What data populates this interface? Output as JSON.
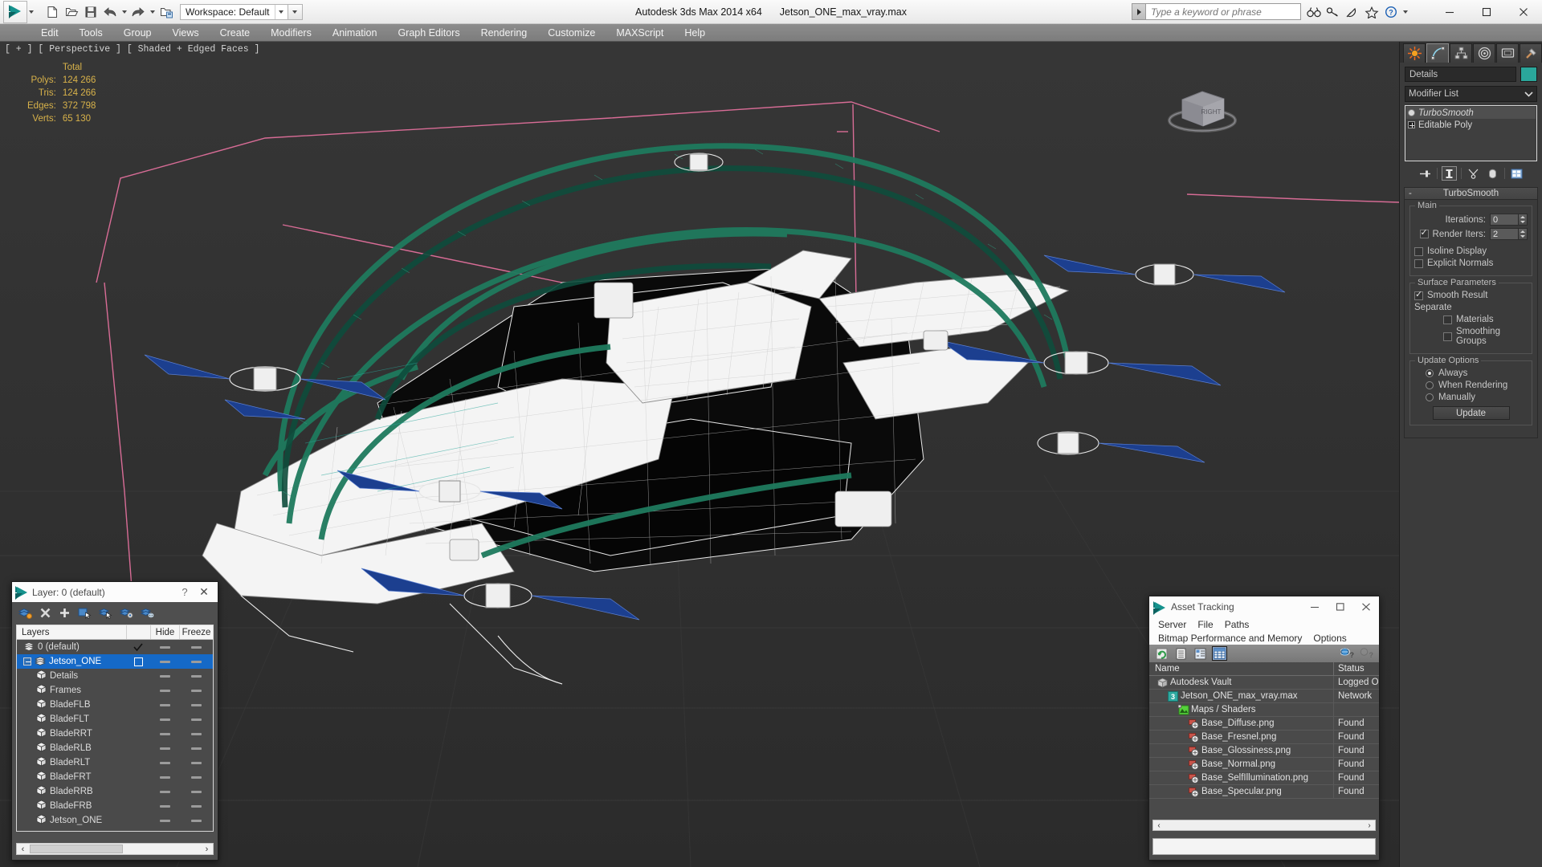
{
  "app": {
    "title": "Autodesk 3ds Max  2014 x64",
    "filename": "Jetson_ONE_max_vray.max",
    "workspace_label": "Workspace: Default",
    "search_placeholder": "Type a keyword or phrase"
  },
  "quick_access": [
    {
      "name": "new-file-icon",
      "glyph": "new"
    },
    {
      "name": "open-file-icon",
      "glyph": "open"
    },
    {
      "name": "save-file-icon",
      "glyph": "save"
    },
    {
      "name": "undo-icon",
      "glyph": "undo"
    },
    {
      "name": "undo-dropdown-icon",
      "glyph": "caret"
    },
    {
      "name": "redo-icon",
      "glyph": "redo"
    },
    {
      "name": "redo-dropdown-icon",
      "glyph": "caret"
    },
    {
      "name": "set-project-folder-icon",
      "glyph": "project"
    }
  ],
  "help_icons": [
    {
      "name": "search-binoculars-icon",
      "glyph": "binoculars"
    },
    {
      "name": "key-icon",
      "glyph": "key"
    },
    {
      "name": "satellite-dish-icon",
      "glyph": "dish"
    },
    {
      "name": "favorites-star-icon",
      "glyph": "star"
    },
    {
      "name": "help-icon",
      "glyph": "question"
    }
  ],
  "window_controls": [
    {
      "name": "minimize-button",
      "glyph": "—"
    },
    {
      "name": "maximize-button",
      "glyph": "☐"
    },
    {
      "name": "close-button",
      "glyph": "✕"
    }
  ],
  "menu": [
    "Edit",
    "Tools",
    "Group",
    "Views",
    "Create",
    "Modifiers",
    "Animation",
    "Graph Editors",
    "Rendering",
    "Customize",
    "MAXScript",
    "Help"
  ],
  "viewport": {
    "label": "[ + ] [ Perspective ] [ Shaded + Edged Faces ]",
    "viewcube_face": "RIGHT",
    "stats": {
      "header": "Total",
      "rows": [
        {
          "label": "Polys:",
          "value": "124 266"
        },
        {
          "label": "Tris:",
          "value": "124 266"
        },
        {
          "label": "Edges:",
          "value": "372 798"
        },
        {
          "label": "Verts:",
          "value": "65 130"
        }
      ]
    }
  },
  "command_panel": {
    "tabs": [
      {
        "name": "create-tab",
        "icon": "star-burst",
        "selected": false
      },
      {
        "name": "modify-tab",
        "icon": "curve",
        "selected": true
      },
      {
        "name": "hierarchy-tab",
        "icon": "hierarchy",
        "selected": false
      },
      {
        "name": "motion-tab",
        "icon": "target-rings",
        "selected": false
      },
      {
        "name": "display-tab",
        "icon": "monitor",
        "selected": false
      },
      {
        "name": "utilities-tab",
        "icon": "hammer",
        "selected": false
      }
    ],
    "object_name": "Details",
    "object_color": "#2aa79b",
    "modifier_list_label": "Modifier List",
    "stack": [
      {
        "name": "TurboSmooth",
        "selected": true,
        "italic": true
      },
      {
        "name": "Editable Poly",
        "selected": false,
        "italic": false
      }
    ],
    "stack_tools": [
      {
        "name": "pin-stack-icon"
      },
      {
        "name": "show-end-result-icon"
      },
      {
        "name": "make-unique-icon"
      },
      {
        "name": "remove-modifier-icon"
      },
      {
        "name": "configure-modifier-sets-icon"
      }
    ],
    "rollout": {
      "title": "TurboSmooth",
      "collapse_glyph": "-",
      "groups": [
        {
          "title": "Main",
          "fields": [
            {
              "type": "spinner",
              "label": "Iterations:",
              "value": "0",
              "checkbox": null
            },
            {
              "type": "spinner",
              "label": "Render Iters:",
              "value": "2",
              "checkbox": true
            },
            {
              "type": "check",
              "label": "Isoline Display",
              "checked": false
            },
            {
              "type": "check",
              "label": "Explicit Normals",
              "checked": false
            }
          ]
        },
        {
          "title": "Surface Parameters",
          "fields": [
            {
              "type": "check",
              "label": "Smooth Result",
              "checked": true
            },
            {
              "type": "text",
              "label": "Separate"
            },
            {
              "type": "check",
              "label": "Materials",
              "checked": false,
              "indent": true
            },
            {
              "type": "check",
              "label": "Smoothing Groups",
              "checked": false,
              "indent": true
            }
          ]
        },
        {
          "title": "Update Options",
          "fields": [
            {
              "type": "radio",
              "label": "Always",
              "checked": true
            },
            {
              "type": "radio",
              "label": "When Rendering",
              "checked": false
            },
            {
              "type": "radio",
              "label": "Manually",
              "checked": false
            },
            {
              "type": "button",
              "label": "Update"
            }
          ]
        }
      ]
    }
  },
  "layer_window": {
    "title": "Layer: 0 (default)",
    "help_glyph": "?",
    "close_glyph": "✕",
    "toolbar": [
      {
        "name": "create-new-layer-icon"
      },
      {
        "name": "delete-highlighted-layers-icon"
      },
      {
        "name": "add-selected-objects-icon"
      },
      {
        "name": "select-objects-in-layer-icon"
      },
      {
        "name": "highlight-selected-objects-layer-icon"
      },
      {
        "name": "hide-unhide-layer-icon"
      },
      {
        "name": "freeze-unfreeze-layer-icon"
      }
    ],
    "columns": [
      "Layers",
      "",
      "Hide",
      "Freeze"
    ],
    "rows": [
      {
        "label": "0 (default)",
        "indent": 0,
        "type": "layer",
        "current": true,
        "selected": false,
        "expander": false
      },
      {
        "label": "Jetson_ONE",
        "indent": 0,
        "type": "layer",
        "current": false,
        "selected": true,
        "expander": true
      },
      {
        "label": "Details",
        "indent": 1,
        "type": "object",
        "current": false,
        "selected": false,
        "expander": false
      },
      {
        "label": "Frames",
        "indent": 1,
        "type": "object",
        "current": false,
        "selected": false,
        "expander": false
      },
      {
        "label": "BladeFLB",
        "indent": 1,
        "type": "object",
        "current": false,
        "selected": false,
        "expander": false
      },
      {
        "label": "BladeFLT",
        "indent": 1,
        "type": "object",
        "current": false,
        "selected": false,
        "expander": false
      },
      {
        "label": "BladeRRT",
        "indent": 1,
        "type": "object",
        "current": false,
        "selected": false,
        "expander": false
      },
      {
        "label": "BladeRLB",
        "indent": 1,
        "type": "object",
        "current": false,
        "selected": false,
        "expander": false
      },
      {
        "label": "BladeRLT",
        "indent": 1,
        "type": "object",
        "current": false,
        "selected": false,
        "expander": false
      },
      {
        "label": "BladeFRT",
        "indent": 1,
        "type": "object",
        "current": false,
        "selected": false,
        "expander": false
      },
      {
        "label": "BladeRRB",
        "indent": 1,
        "type": "object",
        "current": false,
        "selected": false,
        "expander": false
      },
      {
        "label": "BladeFRB",
        "indent": 1,
        "type": "object",
        "current": false,
        "selected": false,
        "expander": false
      },
      {
        "label": "Jetson_ONE",
        "indent": 1,
        "type": "object",
        "current": false,
        "selected": false,
        "expander": false
      }
    ],
    "scroll_left_glyph": "‹",
    "scroll_right_glyph": "›"
  },
  "asset_tracking": {
    "title": "Asset Tracking",
    "window_controls": [
      {
        "name": "asset-minimize-button",
        "glyph": "—"
      },
      {
        "name": "asset-maximize-button",
        "glyph": "☐"
      },
      {
        "name": "asset-close-button",
        "glyph": "✕"
      }
    ],
    "menu_row1": [
      "Server",
      "File",
      "Paths"
    ],
    "menu_row2": [
      "Bitmap Performance and Memory",
      "Options"
    ],
    "toolbar": [
      {
        "name": "refresh-assets-icon",
        "selected": false
      },
      {
        "name": "list-view-icon",
        "selected": false
      },
      {
        "name": "tree-view-icon",
        "selected": false
      },
      {
        "name": "grid-view-icon",
        "selected": true
      },
      {
        "name": "help-globe-icon",
        "selected": false
      },
      {
        "name": "help-dim-icon",
        "selected": false
      }
    ],
    "columns": [
      "Name",
      "Status"
    ],
    "rows": [
      {
        "name": "Autodesk Vault",
        "status": "Logged O",
        "indent": 0,
        "icon": "vault-icon"
      },
      {
        "name": "Jetson_ONE_max_vray.max",
        "status": "Network",
        "indent": 1,
        "icon": "max-file-icon"
      },
      {
        "name": "Maps / Shaders",
        "status": "",
        "indent": 2,
        "icon": "maps-shaders-icon"
      },
      {
        "name": "Base_Diffuse.png",
        "status": "Found",
        "indent": 3,
        "icon": "bitmap-icon"
      },
      {
        "name": "Base_Fresnel.png",
        "status": "Found",
        "indent": 3,
        "icon": "bitmap-icon"
      },
      {
        "name": "Base_Glossiness.png",
        "status": "Found",
        "indent": 3,
        "icon": "bitmap-icon"
      },
      {
        "name": "Base_Normal.png",
        "status": "Found",
        "indent": 3,
        "icon": "bitmap-icon"
      },
      {
        "name": "Base_SelfIllumination.png",
        "status": "Found",
        "indent": 3,
        "icon": "bitmap-icon"
      },
      {
        "name": "Base_Specular.png",
        "status": "Found",
        "indent": 3,
        "icon": "bitmap-icon"
      }
    ],
    "scroll_left_glyph": "‹",
    "scroll_right_glyph": "›"
  },
  "colors": {
    "viewport_bg": "#303030",
    "grid_line": "#3c3c3c",
    "wire_white": "#f2f2f2",
    "wire_green": "#1f7a5e",
    "wire_blue": "#1c3f8f",
    "wire_pink": "#e2709c",
    "stats_text": "#d8b24a",
    "selection_blue": "#1569c7",
    "object_color": "#2aa79b"
  }
}
